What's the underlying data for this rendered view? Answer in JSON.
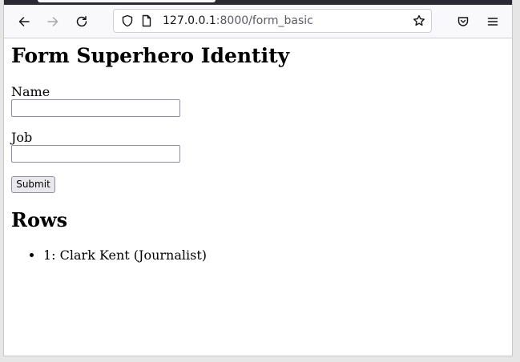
{
  "browser": {
    "url_host": "127.0.0.1",
    "url_rest": ":8000/form_basic"
  },
  "page": {
    "title": "Form Superhero Identity",
    "form": {
      "name_label": "Name",
      "name_value": "",
      "job_label": "Job",
      "job_value": "",
      "submit_label": "Submit"
    },
    "rows_heading": "Rows",
    "rows": [
      "1: Clark Kent (Journalist)"
    ]
  }
}
